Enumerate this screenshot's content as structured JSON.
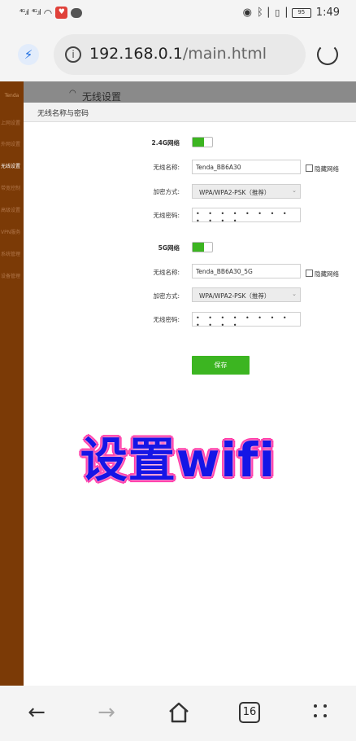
{
  "status_bar": {
    "carrier1": "⁴ᴳ.ıl",
    "carrier2": "⁴ᴳ.ıl",
    "time": "1:49",
    "battery": "95"
  },
  "browser": {
    "url_host": "192.168.0.1",
    "url_path": "/main.html",
    "tab_count": "16"
  },
  "page": {
    "section_title": "无线设置",
    "panel_title": "无线名称与密码",
    "sidebar": {
      "logo": "Tenda",
      "items": [
        "上网设置",
        "外网设置",
        "无线设置",
        "带宽控制",
        "高级设置",
        "VPN服务",
        "系统管理",
        "设备管理"
      ]
    },
    "band24": {
      "label": "2.4G网络",
      "ssid_label": "无线名称:",
      "ssid_value": "Tenda_BB6A30",
      "hide_label": "隐藏网络",
      "enc_label": "加密方式:",
      "enc_value": "WPA/WPA2-PSK（推荐）",
      "pwd_label": "无线密码:",
      "pwd_value": "• • • • • • • • • • • •"
    },
    "band5": {
      "label": "5G网络",
      "ssid_label": "无线名称:",
      "ssid_value": "Tenda_BB6A30_5G",
      "hide_label": "隐藏网络",
      "enc_label": "加密方式:",
      "enc_value": "WPA/WPA2-PSK（推荐）",
      "pwd_label": "无线密码:",
      "pwd_value": "• • • • • • • • • • • •"
    },
    "save_label": "保存",
    "overlay_text": "设置wifi"
  },
  "colors": {
    "accent_green": "#3cb521",
    "sidebar_brown": "#7b3a06",
    "overlay_blue": "#1515e6",
    "overlay_outline": "#ff2fa4"
  }
}
